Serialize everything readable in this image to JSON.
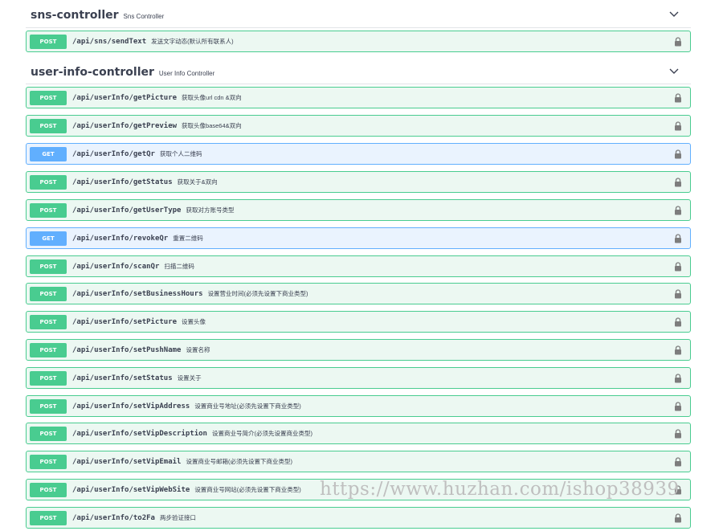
{
  "sections": [
    {
      "name": "sns-controller",
      "description": "Sns Controller",
      "operations": [
        {
          "method": "POST",
          "path": "/api/sns/sendText",
          "summary": "发送文字动态(默认所有联系人)"
        }
      ]
    },
    {
      "name": "user-info-controller",
      "description": "User Info Controller",
      "operations": [
        {
          "method": "POST",
          "path": "/api/userInfo/getPicture",
          "summary": "获取头像url cdn &双向"
        },
        {
          "method": "POST",
          "path": "/api/userInfo/getPreview",
          "summary": "获取头像base64&双向"
        },
        {
          "method": "GET",
          "path": "/api/userInfo/getQr",
          "summary": "获取个人二维码"
        },
        {
          "method": "POST",
          "path": "/api/userInfo/getStatus",
          "summary": "获取关于&双向"
        },
        {
          "method": "POST",
          "path": "/api/userInfo/getUserType",
          "summary": "获取对方账号类型"
        },
        {
          "method": "GET",
          "path": "/api/userInfo/revokeQr",
          "summary": "重置二维码"
        },
        {
          "method": "POST",
          "path": "/api/userInfo/scanQr",
          "summary": "扫描二维码"
        },
        {
          "method": "POST",
          "path": "/api/userInfo/setBusinessHours",
          "summary": "设置营业时间(必须先设置下商业类型)"
        },
        {
          "method": "POST",
          "path": "/api/userInfo/setPicture",
          "summary": "设置头像"
        },
        {
          "method": "POST",
          "path": "/api/userInfo/setPushName",
          "summary": "设置名称"
        },
        {
          "method": "POST",
          "path": "/api/userInfo/setStatus",
          "summary": "设置关于"
        },
        {
          "method": "POST",
          "path": "/api/userInfo/setVipAddress",
          "summary": "设置商业号地址(必须先设置下商业类型)"
        },
        {
          "method": "POST",
          "path": "/api/userInfo/setVipDescription",
          "summary": "设置商业号简介(必须先设置商业类型)"
        },
        {
          "method": "POST",
          "path": "/api/userInfo/setVipEmail",
          "summary": "设置商业号邮箱(必须先设置下商业类型)"
        },
        {
          "method": "POST",
          "path": "/api/userInfo/setVipWebSite",
          "summary": "设置商业号网站(必须先设置下商业类型)"
        },
        {
          "method": "POST",
          "path": "/api/userInfo/to2Fa",
          "summary": "两步验证接口"
        }
      ]
    }
  ],
  "watermark": "https://www.huzhan.com/ishop38939",
  "colors": {
    "post": "#49cc90",
    "get": "#61affe",
    "post_bg": "#ecf8f2",
    "get_bg": "#eaf3fe"
  },
  "icons": {
    "lock": "lock-icon",
    "collapse": "chevron-down-icon"
  }
}
